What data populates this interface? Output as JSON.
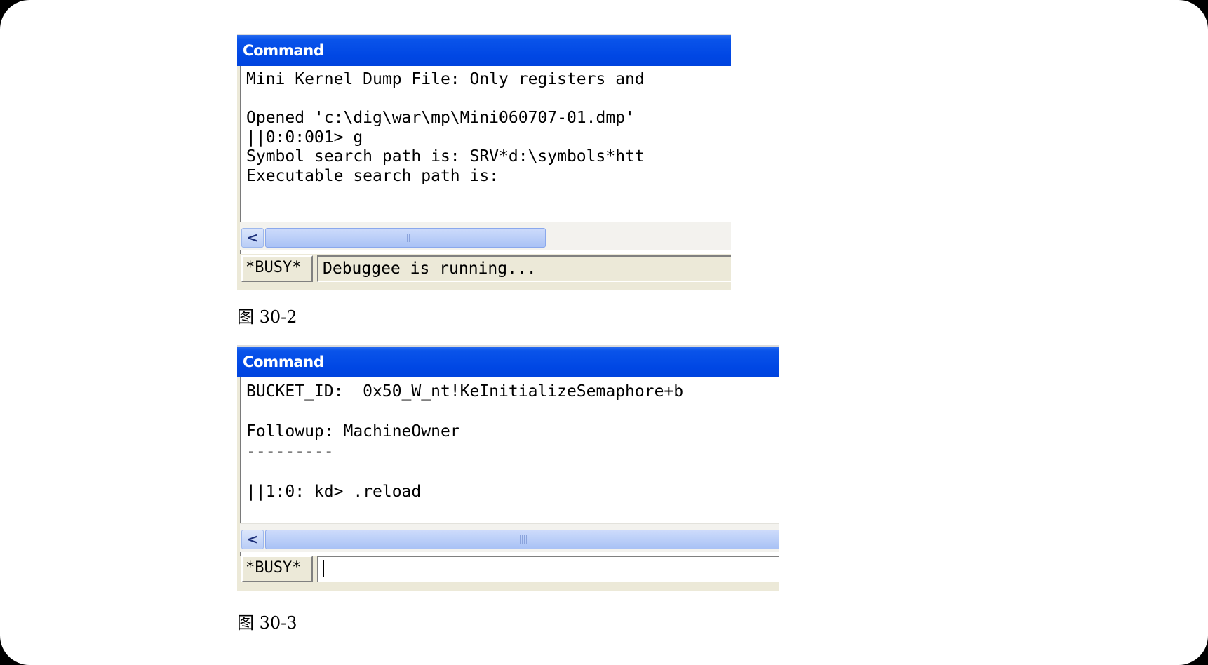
{
  "figures": [
    {
      "window_title": "Command",
      "output_lines": [
        "Mini Kernel Dump File: Only registers and",
        "",
        "Opened 'c:\\dig\\war\\mp\\Mini060707-01.dmp'",
        "||0:0:001> g",
        "Symbol search path is: SRV*d:\\symbols*htt",
        "Executable search path is:"
      ],
      "busy_label": "*BUSY*",
      "status_text": "Debuggee is running...",
      "caption": "图 30-2"
    },
    {
      "window_title": "Command",
      "output_lines": [
        "BUCKET_ID:  0x50_W_nt!KeInitializeSemaphore+b",
        "",
        "Followup: MachineOwner",
        "---------",
        "",
        "||1:0: kd> .reload"
      ],
      "busy_label": "*BUSY*",
      "command_input_value": "",
      "caption": "图 30-3"
    }
  ],
  "colors": {
    "title_bar": "#0047e4",
    "title_text": "#ffffff",
    "window_chrome": "#ece9d8",
    "output_background": "#ffffff",
    "scrollbar_thumb": "#b9cdf6"
  },
  "icons": {
    "scroll_left": "chevron-left-icon",
    "scroll_grip": "grip-icon"
  }
}
